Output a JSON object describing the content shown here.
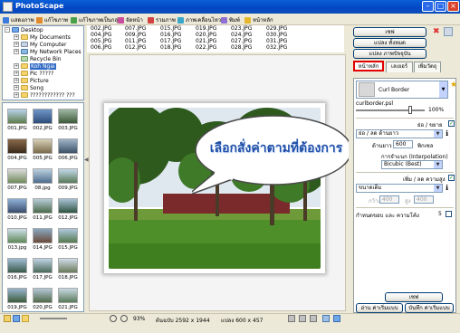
{
  "window": {
    "title": "PhotoScape"
  },
  "toolbar": {
    "items": [
      {
        "label": "แสดงภาพ",
        "color": "#3d7ae0"
      },
      {
        "label": "แก้ไขภาพ",
        "color": "#e08a2d"
      },
      {
        "label": "แก้ไขภาพเป็นกลุ่ม",
        "color": "#4aa04a"
      },
      {
        "label": "จัดหน้า",
        "color": "#c84d9d"
      },
      {
        "label": "รวมภาพ",
        "color": "#d34242"
      },
      {
        "label": "ภาพเคลื่อนไหว",
        "color": "#3aa7c9"
      },
      {
        "label": "พิมพ์",
        "color": "#8f6fd1"
      },
      {
        "label": "หน้าหลัก",
        "color": "#e5b72c"
      }
    ]
  },
  "tree": {
    "items": [
      "Desktop",
      "My Documents",
      "My Computer",
      "My Network Places",
      "Recycle Bin",
      "Koh Ngai",
      "Pic ?????",
      "Picture",
      "Song",
      "???????????? ???"
    ],
    "selected": "Koh Ngai"
  },
  "files": {
    "columns": [
      [
        "002.JPG",
        "004.JPG",
        "005.JPG",
        "006.JPG"
      ],
      [
        "007.JPG",
        "009.JPG",
        "011.JPG",
        "012.JPG"
      ],
      [
        "015.JPG",
        "016.JPG",
        "017.JPG",
        "018.JPG"
      ],
      [
        "019.JPG",
        "020.JPG",
        "021.JPG",
        "022.JPG"
      ],
      [
        "023.JPG",
        "024.JPG",
        "027.JPG",
        "028.JPG"
      ],
      [
        "029.JPG",
        "030.JPG",
        "031.JPG",
        "032.JPG"
      ]
    ]
  },
  "thumbnails": [
    "001.JPG",
    "002.JPG",
    "003.JPG",
    "004.JPG",
    "005.JPG",
    "006.JPG",
    "007.JPG",
    "08.jpg",
    "009.JPG",
    "010.JPG",
    "011.JPG",
    "012.JPG",
    "013.jpg",
    "014.JPG",
    "015.JPG",
    "016.JPG",
    "017.JPG",
    "018.JPG",
    "019.JPG",
    "020.JPG",
    "021.JPG"
  ],
  "preview": {
    "callout": "เลือกสั่งค่าตามที่ต้องการ"
  },
  "status": {
    "zoom": "93%",
    "original_size": "ต้นฉบับ 2592 x 1944",
    "converted_size": "แปลง 600 x 457"
  },
  "panel": {
    "save_button": "เซฟ",
    "convert_all_button": "แปลง ทั้งหมด",
    "convert_current_button": "แปลง ภาพปัจจุบัน",
    "tabs": [
      "หน้าหลัก",
      "เลเยอร์",
      "เพิ่มวัตถุ"
    ],
    "frame_name": "Curl Border",
    "frame_file": "curlborder.psl",
    "opacity": "100%",
    "resize_header": "ย่อ / ขยาย",
    "resize_mode": "ย่อ / ลด ด้านยาว",
    "long_side_label": "ด้านยาว",
    "long_side_value": "600",
    "pixel_label": "พิกเซล",
    "interp_label": "การจำแนก (Interpolation)",
    "interp_value": "Bicubic (Best)",
    "enlarge_label": "เพิ่ม / ลด ความสูง",
    "size_mode": "ขนาดเต็ม",
    "width_label": "กว้าง",
    "width_value": "400",
    "height_label": "สูง",
    "height_value": "400",
    "ratio_label": "กำหนดขอบ และ ความโค้ง",
    "ratio_value": "5",
    "save_small": "เซฟ",
    "load_preset": "อ่าน ค่าเริ่มแบบ",
    "save_preset": "บันทึก ค่าเริ่มแบบ"
  }
}
